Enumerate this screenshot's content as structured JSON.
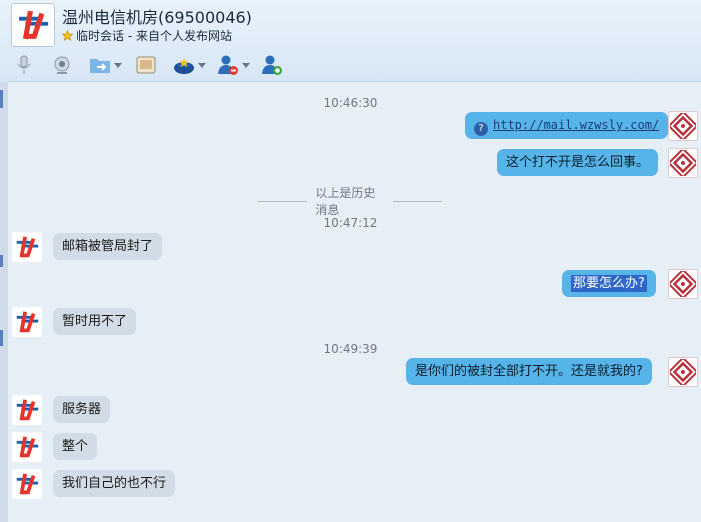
{
  "header": {
    "contact_name": "温州电信机房(69500046)",
    "session_note": "临时会话 - 来自个人发布网站"
  },
  "toolbar": {
    "icons": [
      "microphone-icon",
      "webcam-icon",
      "send-file-icon",
      "screenshot-icon",
      "apps-icon",
      "remove-contact-icon",
      "add-contact-icon"
    ]
  },
  "chat": {
    "history_label": "以上是历史消息",
    "timestamps": [
      "10:46:30",
      "10:47:12",
      "10:49:39"
    ],
    "messages": [
      {
        "side": "out",
        "text": "http://mail.wzwsly.com/"
      },
      {
        "side": "out",
        "text": "这个打不开是怎么回事。"
      },
      {
        "side": "in",
        "text": "邮箱被管局封了"
      },
      {
        "side": "out",
        "text": "那要怎么办?"
      },
      {
        "side": "in",
        "text": "暂时用不了"
      },
      {
        "side": "out",
        "text": "是你们的被封全部打不开。还是就我的?"
      },
      {
        "side": "in",
        "text": "服务器"
      },
      {
        "side": "in",
        "text": "整个"
      },
      {
        "side": "in",
        "text": "我们自己的也不行"
      }
    ]
  },
  "colors": {
    "outgoing_bubble": "#57b4e8",
    "incoming_bubble": "#d2dce6",
    "background": "#e6eef6",
    "peer_logo_red": "#e8332c",
    "peer_logo_blue": "#1f5fb0",
    "self_avatar_red": "#b8303a"
  }
}
